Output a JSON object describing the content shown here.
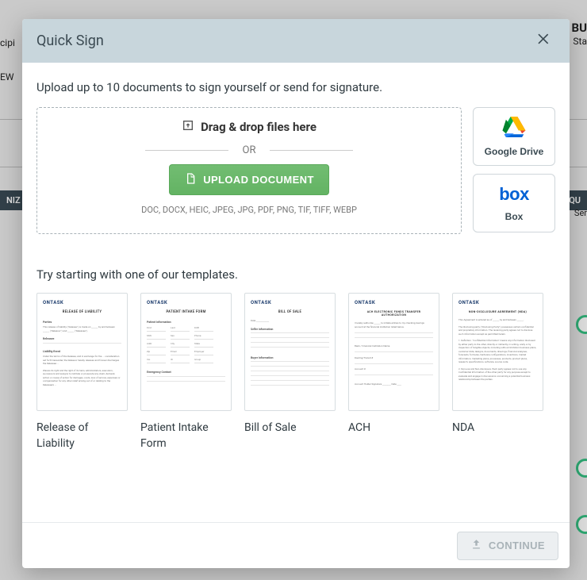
{
  "modal": {
    "title": "Quick Sign",
    "upload_intro": "Upload up to 10 documents to sign yourself or send for signature.",
    "dd_title": "Drag & drop files here",
    "or_text": "OR",
    "upload_button": "UPLOAD DOCUMENT",
    "formats": "DOC, DOCX, HEIC, JPEG, JPG, PDF, PNG, TIF, TIFF, WEBP",
    "providers": {
      "google_drive": "Google Drive",
      "box": "Box",
      "box_logo": "box"
    },
    "templates_title": "Try starting with one of our templates.",
    "templates": [
      {
        "label": "Release of Liability",
        "title": "RELEASE OF LIABILITY"
      },
      {
        "label": "Patient Intake Form",
        "title": "PATIENT INTAKE FORM"
      },
      {
        "label": "Bill of Sale",
        "title": "BILL OF SALE"
      },
      {
        "label": "ACH",
        "title": "ACH ELECTRONIC FUNDS TRANSFER AUTHORIZATION"
      },
      {
        "label": "NDA",
        "title": "NON-DISCLOSURE AGREEMENT (NDA)"
      }
    ],
    "continue": "CONTINUE",
    "doc_brand": "ONTASK"
  },
  "bg": {
    "cipi": "cipi",
    "ew": "EW",
    "niz": "NIZ",
    "bu": "BU",
    "sta": "Sta",
    "qu": "QU",
    "ser": "Ser"
  }
}
